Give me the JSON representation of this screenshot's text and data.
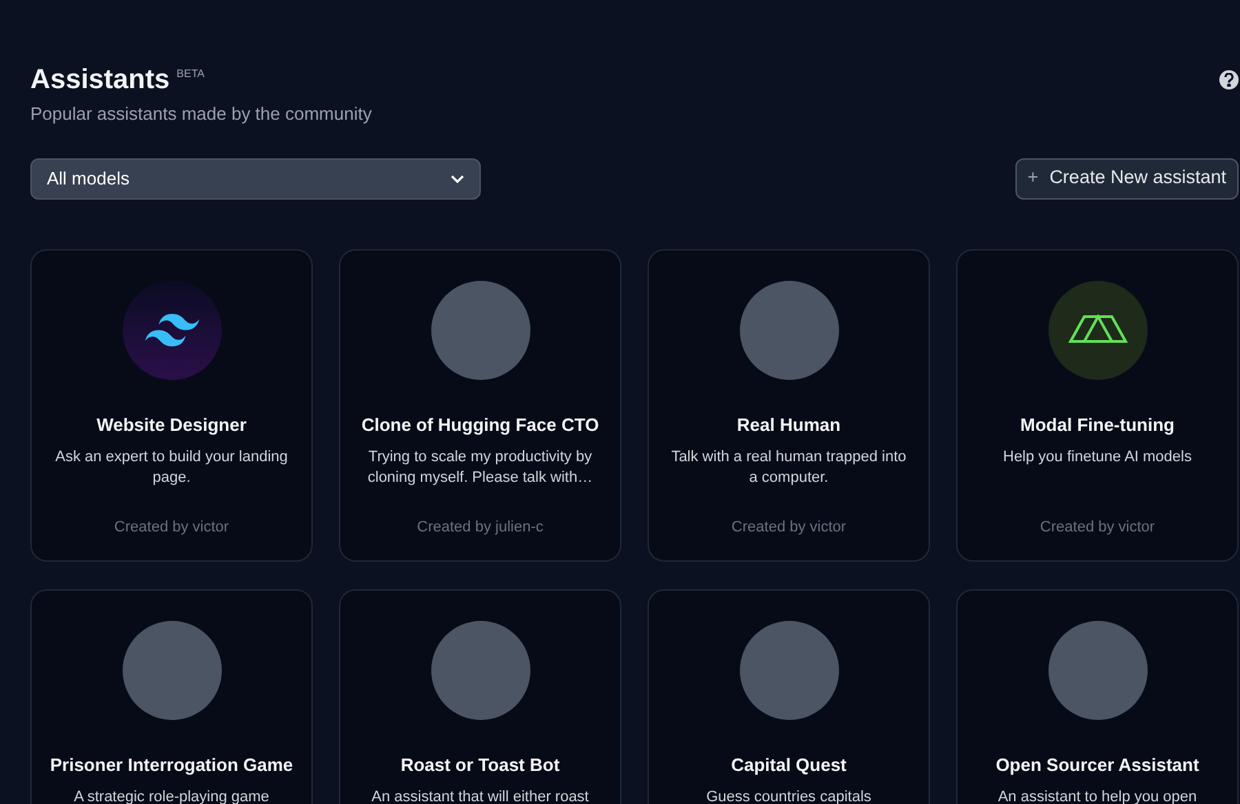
{
  "header": {
    "title": "Assistants",
    "badge": "BETA",
    "subtitle": "Popular assistants made by the community"
  },
  "model_filter": {
    "value": "All models"
  },
  "create_button": {
    "icon": "+",
    "label": "Create New assistant"
  },
  "assistants": [
    {
      "name": "Website Designer",
      "description": "Ask an expert to build your landing page.",
      "author": "Created by victor",
      "avatar": {
        "kind": "tailwind-logo"
      }
    },
    {
      "name": "Clone of Hugging Face CTO",
      "description": "Trying to scale my productivity by cloning myself. Please talk with…",
      "author": "Created by julien-c",
      "avatar": {
        "kind": "photo"
      }
    },
    {
      "name": "Real Human",
      "description": "Talk with a real human trapped into a computer.",
      "author": "Created by victor",
      "avatar": {
        "kind": "photo"
      }
    },
    {
      "name": "Modal Fine-tuning",
      "description": "Help you finetune AI models",
      "author": "Created by victor",
      "avatar": {
        "kind": "modal-logo"
      }
    },
    {
      "name": "Prisoner Interrogation Game",
      "description": "A strategic role-playing game",
      "avatar": {
        "kind": "photo"
      }
    },
    {
      "name": "Roast or Toast Bot",
      "description": "An assistant that will either roast",
      "avatar": {
        "kind": "photo"
      }
    },
    {
      "name": "Capital Quest",
      "description": "Guess countries capitals",
      "avatar": {
        "kind": "photo"
      }
    },
    {
      "name": "Open Sourcer Assistant",
      "description": "An assistant to help you open",
      "avatar": {
        "kind": "photo"
      }
    }
  ]
}
